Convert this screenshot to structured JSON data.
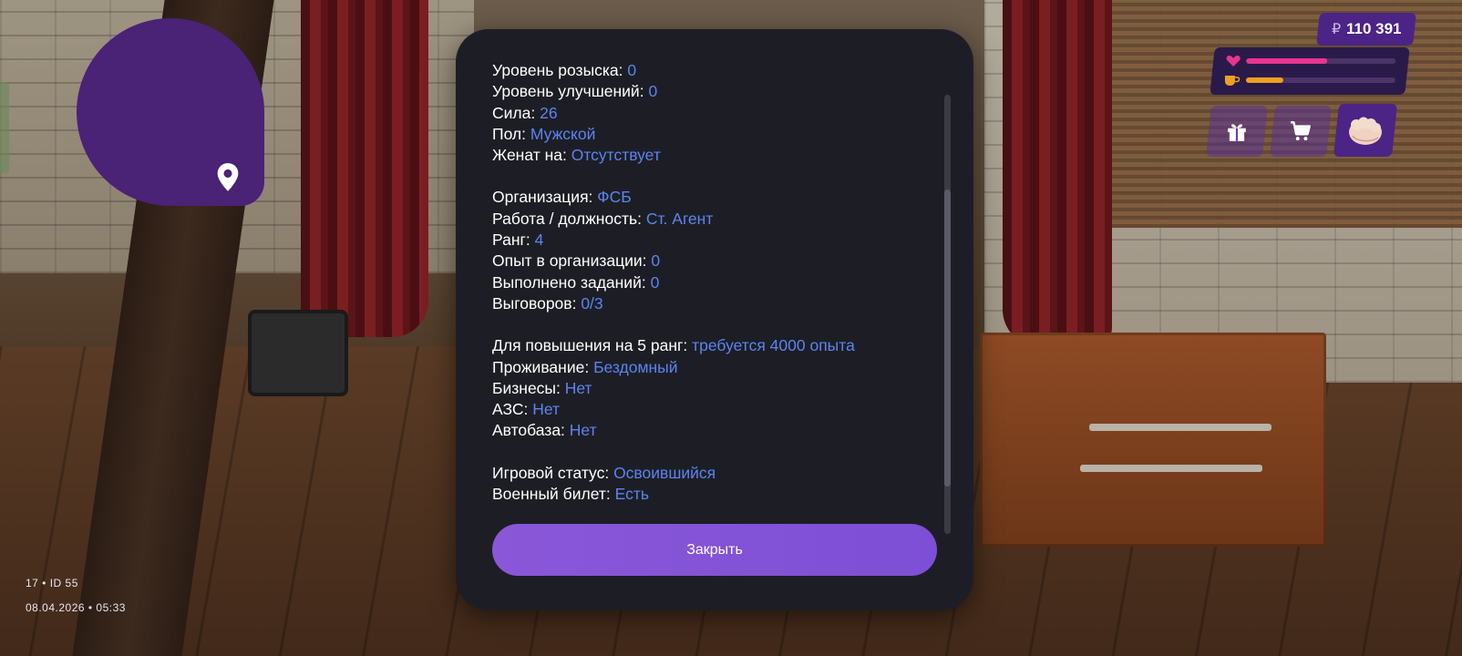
{
  "hud": {
    "money": "110 391",
    "health_level": 0.54,
    "hunger_level": 0.25,
    "colors": {
      "accent": "#4b2485",
      "health": "#e8348f",
      "hunger": "#f0a020",
      "value_text": "#5b84f0",
      "button": "#8a57d8"
    },
    "buttons": [
      {
        "name": "gift",
        "icon": "gift-icon"
      },
      {
        "name": "shop",
        "icon": "cart-icon"
      },
      {
        "name": "fist",
        "icon": "fist-icon"
      }
    ]
  },
  "minimap": {
    "icon": "location-pin-icon"
  },
  "player": {
    "id_line": "17 • ID 55",
    "datetime": "08.04.2026 • 05:33"
  },
  "stats_modal": {
    "groups": [
      [
        {
          "label": "Уровень розыска: ",
          "value": "0"
        },
        {
          "label": "Уровень улучшений: ",
          "value": "0"
        },
        {
          "label": "Сила: ",
          "value": "26"
        },
        {
          "label": "Пол: ",
          "value": "Мужской"
        },
        {
          "label": "Женат на: ",
          "value": "Отсутствует"
        }
      ],
      [
        {
          "label": "Организация: ",
          "value": "ФСБ"
        },
        {
          "label": "Работа / должность: ",
          "value": "Ст. Агент"
        },
        {
          "label": "Ранг: ",
          "value": "4"
        },
        {
          "label": "Опыт в организации: ",
          "value": "0"
        },
        {
          "label": "Выполнено заданий: ",
          "value": "0"
        },
        {
          "label": "Выговоров: ",
          "value": "0/3"
        }
      ],
      [
        {
          "label": "Для повышения на 5 ранг: ",
          "value": "требуется 4000 опыта"
        },
        {
          "label": "Проживание: ",
          "value": "Бездомный"
        },
        {
          "label": "Бизнесы: ",
          "value": "Нет"
        },
        {
          "label": "АЗС: ",
          "value": "Нет"
        },
        {
          "label": "Автобаза: ",
          "value": "Нет"
        }
      ],
      [
        {
          "label": "Игровой статус: ",
          "value": "Освоившийся"
        },
        {
          "label": "Военный билет: ",
          "value": "Есть"
        }
      ]
    ],
    "scroll_position": 0.32,
    "close_label": "Закрыть"
  }
}
